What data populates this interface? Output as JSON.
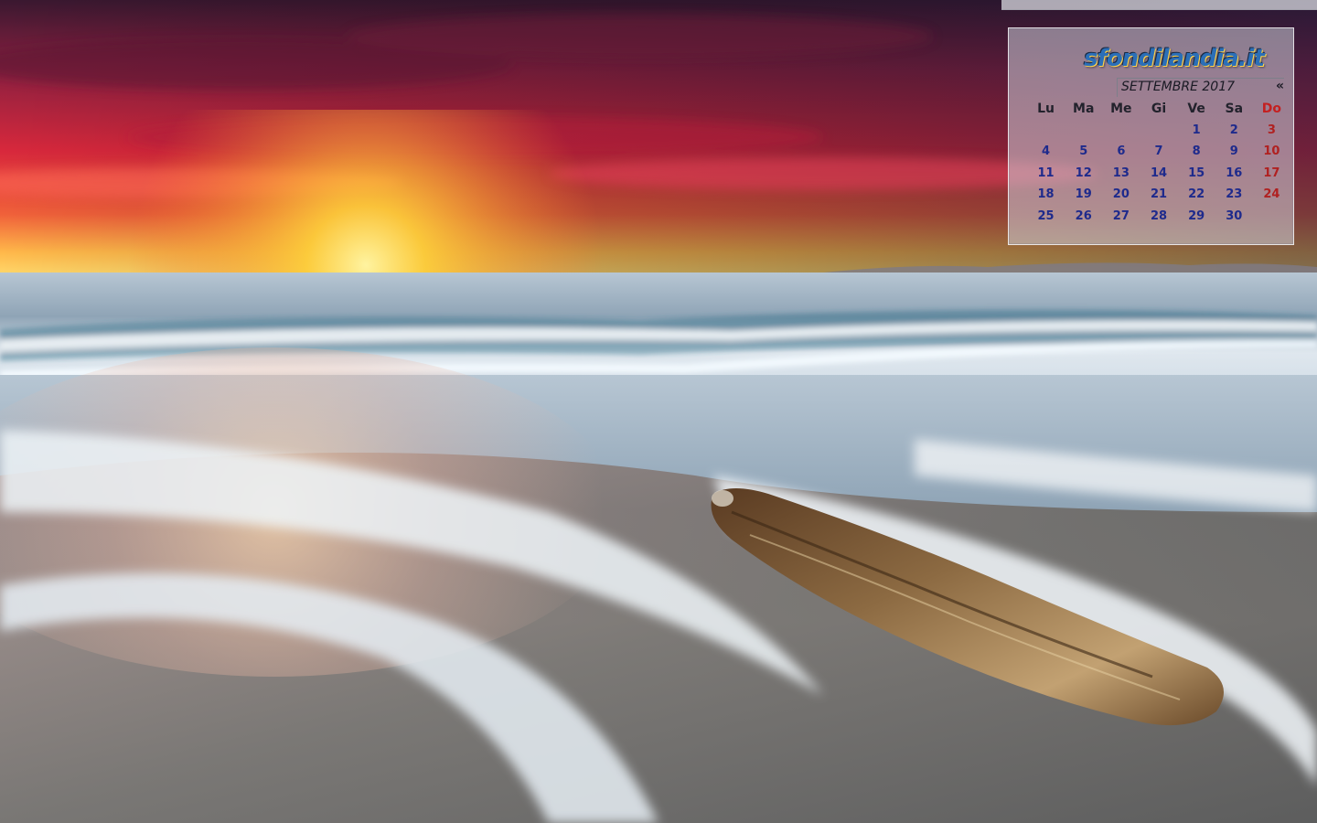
{
  "calendar": {
    "brand": "sfondilandia.it",
    "month_label": "SETTEMBRE 2017",
    "nav_label": "«",
    "weekdays": [
      "Lu",
      "Ma",
      "Me",
      "Gi",
      "Ve",
      "Sa",
      "Do"
    ],
    "weeks": [
      [
        "",
        "",
        "",
        "",
        "1",
        "2",
        "3"
      ],
      [
        "4",
        "5",
        "6",
        "7",
        "8",
        "9",
        "10"
      ],
      [
        "11",
        "12",
        "13",
        "14",
        "15",
        "16",
        "17"
      ],
      [
        "18",
        "19",
        "20",
        "21",
        "22",
        "23",
        "24"
      ],
      [
        "25",
        "26",
        "27",
        "28",
        "29",
        "30",
        ""
      ]
    ],
    "colors": {
      "day_number": "#1e2a8c",
      "sunday": "#b02020"
    }
  },
  "scene": {
    "description_colors": {
      "sky_top": "#4a1f3c",
      "sky_red": "#d8283c",
      "sun_glow": "#ffd23a",
      "sea": "#c9d4dd",
      "sand": "#6f6a66",
      "driftwood": "#8a6a44"
    }
  }
}
